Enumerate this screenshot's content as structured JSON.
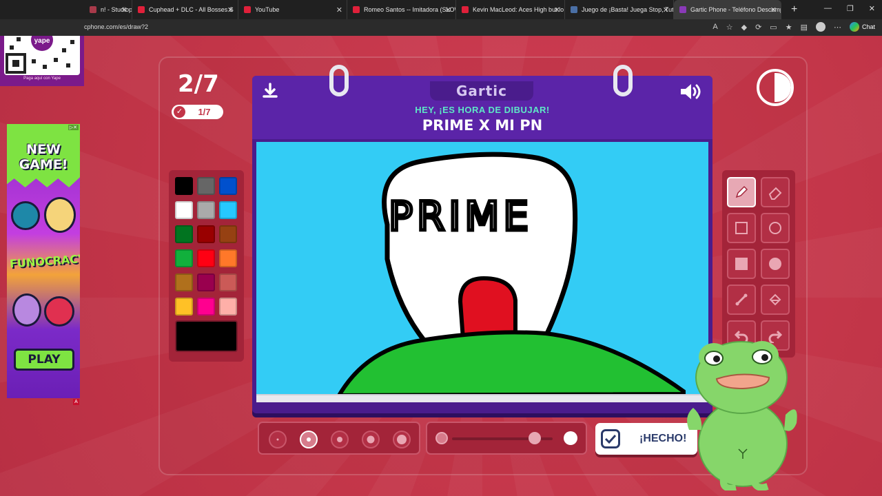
{
  "browser": {
    "tabs": [
      {
        "title": "n! - Studiopu",
        "color": "#a83a4a"
      },
      {
        "title": "Cuphead + DLC - All Bosses S",
        "color": "#e0203a"
      },
      {
        "title": "YouTube",
        "color": "#e0203a"
      },
      {
        "title": "Romeo Santos -- Imitadora (SLOW",
        "color": "#e0203a"
      },
      {
        "title": "Kevin MacLeod: Aces High but lo",
        "color": "#e0203a"
      },
      {
        "title": "Juego de ¡Basta! Juega Stop, Tutti",
        "color": "#4a6fa5"
      },
      {
        "title": "Gartic Phone - Teléfono Descomp",
        "color": "#8a3ab8"
      }
    ],
    "url": "cphone.com/es/draw?2",
    "chat_label": "Chat",
    "reader_label": "A"
  },
  "ad": {
    "new_game": "NEW GAME!",
    "brand": "FUNOCRACY",
    "play": "PLAY",
    "qr_caption": "Paga aquí con Yape"
  },
  "game": {
    "round": "2/7",
    "done_count": "1/7",
    "logo": "Gartic",
    "subtitle": "HEY, ¡ES HORA DE DIBUJAR!",
    "theme": "PRIME X MI PN",
    "done_button": "¡HECHO!",
    "drawing_text": "PRIME"
  },
  "palette": [
    "#000000",
    "#666666",
    "#0050cd",
    "#ffffff",
    "#aaaaaa",
    "#26c9ff",
    "#017420",
    "#990000",
    "#964112",
    "#11b03c",
    "#ff0013",
    "#ff7829",
    "#b0701c",
    "#99004e",
    "#cb5a57",
    "#ffc126",
    "#ff008f",
    "#feafa8"
  ],
  "current_color": "#000000",
  "brush_size_selected": 1,
  "opacity_level": 0.82,
  "colors": {
    "page_bg": "#c23548",
    "book": "#5b24a8",
    "canvas": "#33ccf5",
    "accent_teal": "#5ee8c7"
  }
}
